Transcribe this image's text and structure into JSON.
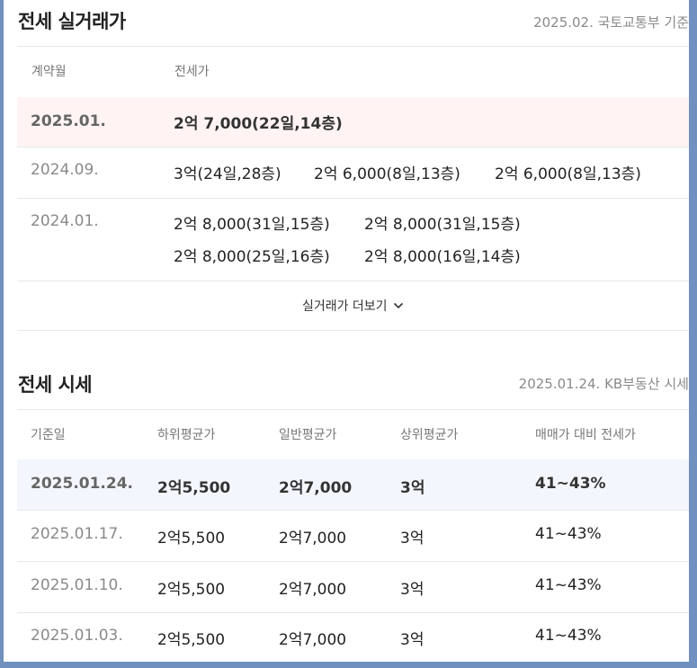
{
  "jeonse_deals": {
    "title": "전세 실거래가",
    "source": "2025.02. 국토교통부 기준",
    "headers": {
      "month": "계약월",
      "price": "전세가"
    },
    "rows": [
      {
        "month": "2025.01.",
        "lines": [
          [
            "2억 7,000(22일,14층)"
          ]
        ]
      },
      {
        "month": "2024.09.",
        "lines": [
          [
            "3억(24일,28층)",
            "2억 6,000(8일,13층)",
            "2억 6,000(8일,13층)"
          ]
        ]
      },
      {
        "month": "2024.01.",
        "lines": [
          [
            "2억 8,000(31일,15층)",
            "2억 8,000(31일,15층)"
          ],
          [
            "2억 8,000(25일,16층)",
            "2억 8,000(16일,14층)"
          ]
        ]
      }
    ],
    "more_label": "실거래가 더보기"
  },
  "jeonse_quotes": {
    "title": "전세 시세",
    "source": "2025.01.24. KB부동산 시세",
    "headers": [
      "기준일",
      "하위평균가",
      "일반평균가",
      "상위평균가",
      "매매가 대비 전세가"
    ],
    "rows": [
      [
        "2025.01.24.",
        "2억5,500",
        "2억7,000",
        "3억",
        "41~43%"
      ],
      [
        "2025.01.17.",
        "2억5,500",
        "2억7,000",
        "3억",
        "41~43%"
      ],
      [
        "2025.01.10.",
        "2억5,500",
        "2억7,000",
        "3억",
        "41~43%"
      ],
      [
        "2025.01.03.",
        "2억5,500",
        "2억7,000",
        "3억",
        "41~43%"
      ]
    ]
  },
  "icons": {
    "more": "chevron-down-icon"
  },
  "colors": {
    "highlight_red": "#fff4f3",
    "highlight_blue": "#f3f7fd",
    "frame": "#7090bf"
  }
}
